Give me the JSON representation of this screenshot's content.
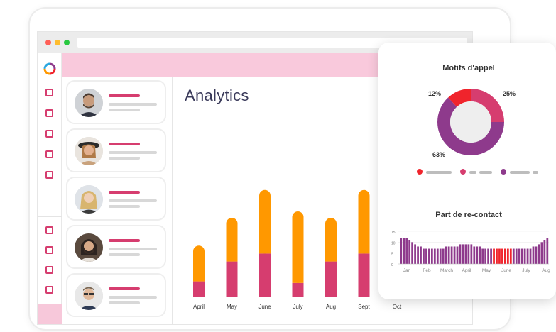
{
  "main": {
    "title": "Analytics"
  },
  "chart_data": [
    {
      "type": "bar",
      "stacked": true,
      "categories": [
        "April",
        "May",
        "June",
        "July",
        "Aug",
        "Sept",
        "Oct"
      ],
      "series": [
        {
          "values": [
            2,
            4.5,
            5.5,
            1.8,
            4.5,
            5.5,
            4.2
          ],
          "color": "#d63d6f"
        },
        {
          "values": [
            4.5,
            5.5,
            8,
            9,
            5.5,
            8,
            7
          ],
          "color": "#ff9800"
        }
      ]
    },
    {
      "type": "pie",
      "donut": true,
      "title": "Motifs d'appel",
      "slices": [
        {
          "label": "12%",
          "value": 12,
          "color": "#f0242c"
        },
        {
          "label": "25%",
          "value": 25,
          "color": "#d63d6f"
        },
        {
          "label": "63%",
          "value": 63,
          "color": "#8e3a8c"
        }
      ]
    },
    {
      "type": "bar",
      "title": "Part de re-contact",
      "yticks": [
        "15",
        "10",
        "5",
        "0"
      ],
      "ylim": [
        0,
        15
      ],
      "xlabels": [
        "Jan",
        "Feb",
        "March",
        "April",
        "May",
        "June",
        "July",
        "Aug"
      ],
      "values": [
        12,
        12,
        12,
        11,
        10,
        9,
        8,
        8,
        7,
        7,
        7,
        7,
        7,
        7,
        7,
        7,
        8,
        8,
        8,
        8,
        8,
        9,
        9,
        9,
        9,
        9,
        8,
        8,
        8,
        7,
        7,
        7,
        7,
        7,
        7,
        7,
        7,
        7,
        7,
        7,
        7,
        7,
        7,
        7,
        7,
        7,
        7,
        8,
        8,
        9,
        10,
        11,
        12
      ],
      "highlight_range": [
        33,
        39
      ],
      "colors": {
        "normal": "#8e3a8c",
        "highlight": "#f0242c"
      }
    }
  ],
  "colors": {
    "accent": "#d63d6f",
    "orange": "#ff9800",
    "purple": "#8e3a8c",
    "red": "#f0242c"
  }
}
